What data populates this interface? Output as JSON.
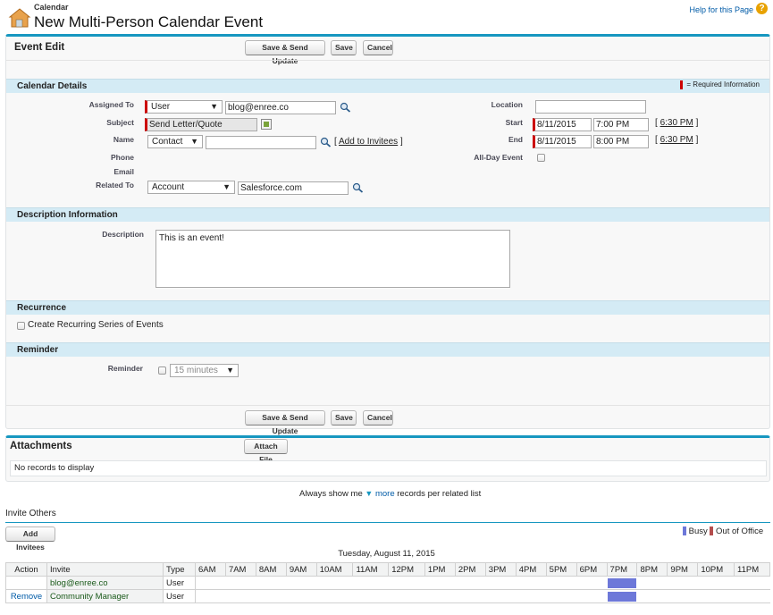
{
  "header": {
    "breadcrumb": "Calendar",
    "title": "New Multi-Person Calendar Event",
    "help_link": "Help for this Page",
    "help_icon": "?"
  },
  "event_edit": {
    "title": "Event Edit",
    "save_send_label": "Save & Send Update",
    "save_label": "Save",
    "cancel_label": "Cancel"
  },
  "calendar_details": {
    "title": "Calendar Details",
    "required_info": "= Required Information",
    "assigned_to_label": "Assigned To",
    "assigned_to_type": "User",
    "assigned_to_value": "blog@enree.co",
    "subject_label": "Subject",
    "subject_value": "Send Letter/Quote",
    "name_label": "Name",
    "name_type": "Contact",
    "name_value": "",
    "add_to_invitees": "Add to Invitees",
    "phone_label": "Phone",
    "email_label": "Email",
    "related_to_label": "Related To",
    "related_to_type": "Account",
    "related_to_value": "Salesforce.com",
    "location_label": "Location",
    "location_value": "",
    "start_label": "Start",
    "start_date": "8/11/2015",
    "start_time": "7:00 PM",
    "start_now": "6:30 PM",
    "end_label": "End",
    "end_date": "8/11/2015",
    "end_time": "8:00 PM",
    "end_now": "6:30 PM",
    "allday_label": "All-Day Event"
  },
  "description": {
    "title": "Description Information",
    "label": "Description",
    "value": "This is an event!"
  },
  "recurrence": {
    "title": "Recurrence",
    "checkbox_label": "Create Recurring Series of Events"
  },
  "reminder": {
    "title": "Reminder",
    "label": "Reminder",
    "value": "15 minutes"
  },
  "attachments": {
    "title": "Attachments",
    "attach_label": "Attach File",
    "empty_text": "No records to display"
  },
  "always_show": {
    "prefix": "Always show me",
    "more": "more",
    "suffix": "records per related list"
  },
  "invite": {
    "title": "Invite Others",
    "add_invitees": "Add Invitees",
    "legend_busy": "Busy",
    "legend_out": "Out of Office",
    "busy_color": "#6d78d9",
    "out_color": "#b44d4d",
    "date": "Tuesday, August 11, 2015",
    "columns": [
      "Action",
      "Invite",
      "Type"
    ],
    "hours": [
      "6AM",
      "7AM",
      "8AM",
      "9AM",
      "10AM",
      "11AM",
      "12PM",
      "1PM",
      "2PM",
      "3PM",
      "4PM",
      "5PM",
      "6PM",
      "7PM",
      "8PM",
      "9PM",
      "10PM",
      "11PM"
    ],
    "rows": [
      {
        "action": "",
        "invite": "blog@enree.co",
        "type": "User",
        "busy_hour": "7PM"
      },
      {
        "action": "Remove",
        "invite": "Community Manager",
        "type": "User",
        "busy_hour": "7PM"
      }
    ]
  }
}
